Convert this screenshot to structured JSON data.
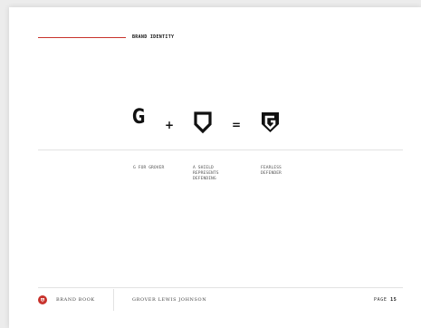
{
  "header": {
    "section_title": "BRAND IDENTITY"
  },
  "equation": {
    "letter": "G",
    "plus": "+",
    "equals": "=",
    "shield_icon": "shield-icon",
    "result_icon": "grover-logo-icon"
  },
  "captions": [
    "G FOR GROVER",
    "A SHIELD\nREPRESENTS\nDEFENDING",
    "FEARLESS\nDEFENDER"
  ],
  "footer": {
    "brand_book": "BRAND BOOK",
    "name": "GROVER LEWIS JOHNSON",
    "page_label": "PAGE",
    "page_number": "15"
  },
  "colors": {
    "accent": "#c8322c",
    "ink": "#111111"
  }
}
